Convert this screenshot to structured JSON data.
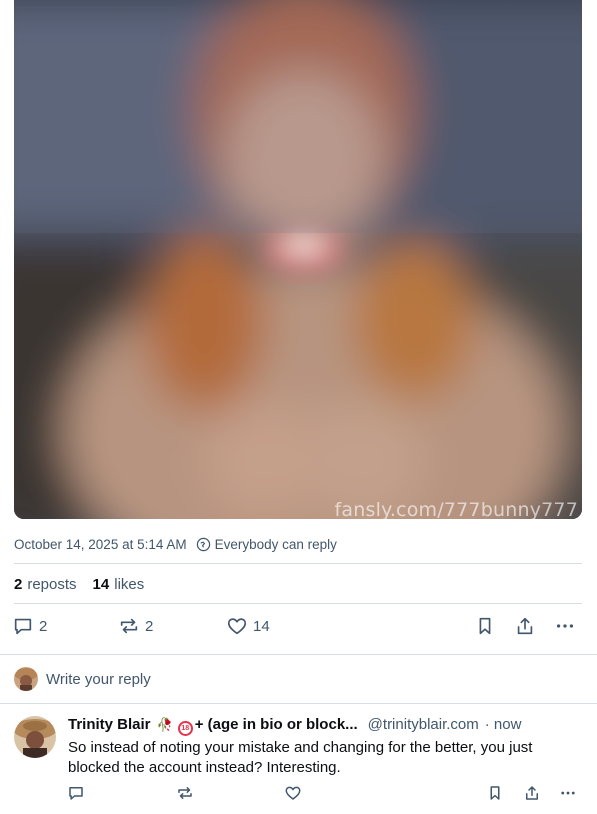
{
  "post": {
    "media": {
      "watermark": "fansly.com/777bunny777"
    },
    "timestamp": "October 14, 2025 at 5:14 AM",
    "reply_setting": "Everybody can reply",
    "stats": {
      "reposts_count": "2",
      "reposts_label": "reposts",
      "likes_count": "14",
      "likes_label": "likes"
    },
    "actions": {
      "reply_count": "2",
      "repost_count": "2",
      "like_count": "14"
    }
  },
  "reply_composer": {
    "placeholder": "Write your reply"
  },
  "comments": [
    {
      "display_name": "Trinity Blair",
      "name_emoji": "🥀",
      "badge_text": "18",
      "name_suffix": "+ (age in bio or block...",
      "handle": "@trinityblair.com",
      "time": "· now",
      "text": "So instead of noting your mistake and changing for the better, you just blocked the account instead? Interesting."
    }
  ],
  "colors": {
    "muted_text": "#42576c",
    "divider": "#d9dee3",
    "badge_red": "#e8334a"
  }
}
